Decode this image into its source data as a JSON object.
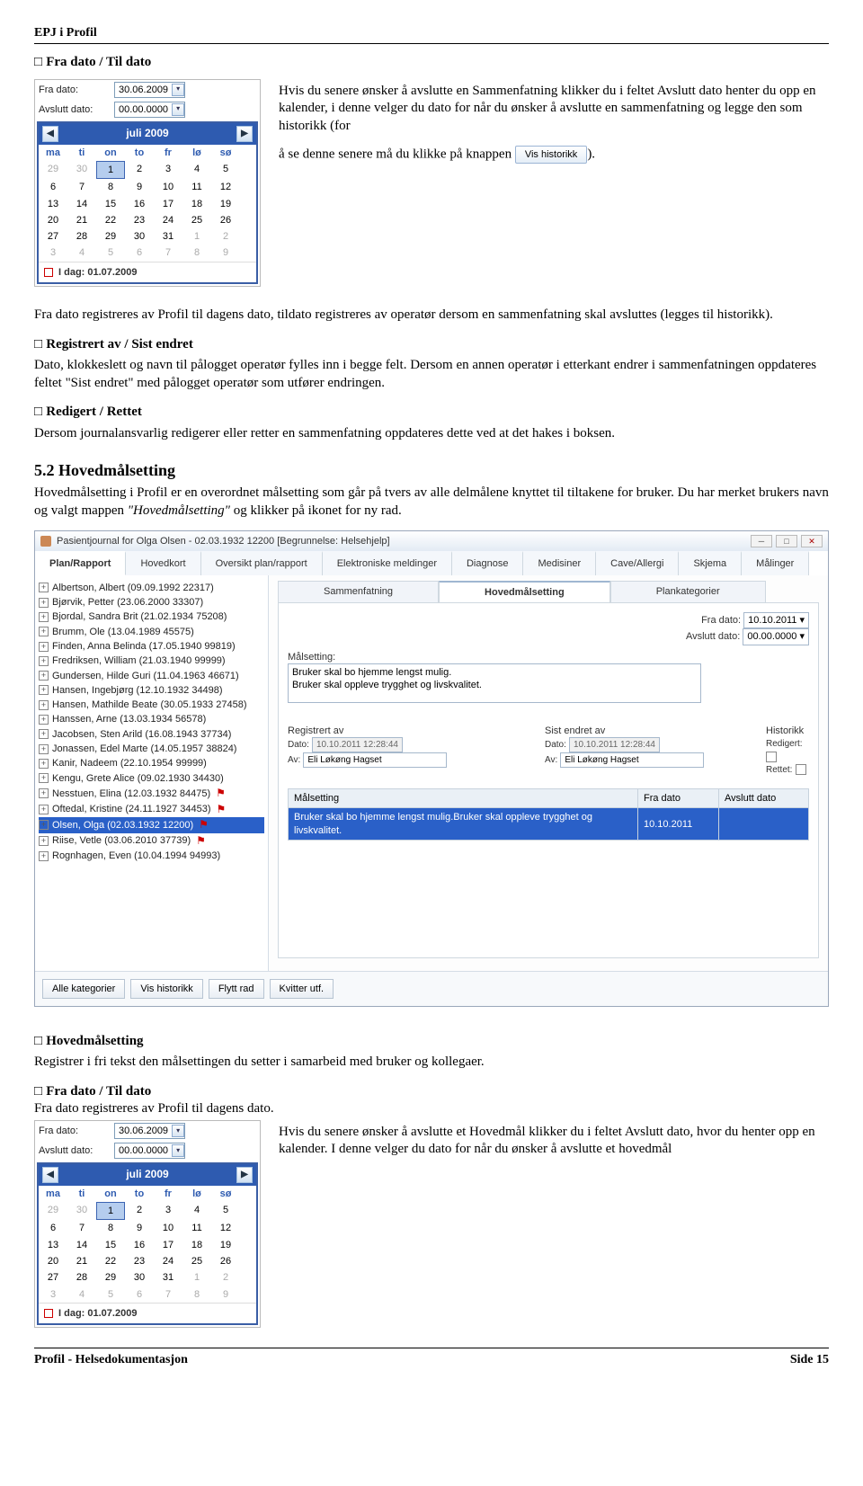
{
  "doc": {
    "header": "EPJ i Profil",
    "s1_title": "Fra dato / Til dato",
    "s1_p1": "Hvis du senere ønsker å avslutte en Sammenfatning klikker du i feltet Avslutt dato henter du opp en kalender, i denne velger du dato for når du ønsker å avslutte en sammenfatning og legge den som historikk (for",
    "s1_p2a": "å se denne senere må du klikke på knappen ",
    "s1_p2b": ").",
    "s1_p3": "Fra dato registreres av Profil til dagens dato, tildato registreres av operatør dersom en sammenfatning skal avsluttes (legges til historikk).",
    "s2_title": "Registrert av / Sist endret",
    "s2_p": "Dato, klokkeslett og navn til pålogget operatør fylles inn i begge felt. Dersom en annen operatør i etterkant endrer i sammenfatningen oppdateres feltet \"Sist endret\" med pålogget operatør som utfører endringen.",
    "s3_title": "Redigert / Rettet",
    "s3_p": "Dersom journalansvarlig redigerer eller retter en sammenfatning oppdateres dette ved at det hakes i boksen.",
    "h52": "5.2 Hovedmålsetting",
    "h52_p": "Hovedmålsetting i Profil er en overordnet målsetting som går på tvers av alle delmålene knyttet til tiltakene for bruker.  Du har merket brukers navn og valgt mappen \"Hovedmålsetting\" og klikker på ikonet for ny rad.",
    "s4_title": "Hovedmålsetting",
    "s4_p": "Registrer i fri tekst den målsettingen du setter i samarbeid med bruker og kollegaer.",
    "s5_title": "Fra dato / Til dato",
    "s5_line": "Fra dato registreres av Profil til dagens dato.",
    "s5_p": "Hvis du senere ønsker å avslutte et Hovedmål klikker du i feltet Avslutt dato, hvor du henter opp en kalender. I denne velger du dato for når du ønsker å avslutte et hovedmål",
    "footer_left": "Profil - Helsedokumentasjon",
    "footer_right": "Side 15"
  },
  "vis_btn": "Vis historikk",
  "dp": {
    "fra_lbl": "Fra dato:",
    "avs_lbl": "Avslutt dato:",
    "fra_val": "30.06.2009",
    "avs_val": "00.00.0000",
    "month": "juli 2009",
    "days": [
      "ma",
      "ti",
      "on",
      "to",
      "fr",
      "lø",
      "sø"
    ],
    "cells": [
      {
        "t": "29",
        "g": 1
      },
      {
        "t": "30",
        "g": 1
      },
      {
        "t": "1",
        "s": 1
      },
      {
        "t": "2"
      },
      {
        "t": "3"
      },
      {
        "t": "4"
      },
      {
        "t": "5"
      },
      {
        "t": "6"
      },
      {
        "t": "7"
      },
      {
        "t": "8"
      },
      {
        "t": "9"
      },
      {
        "t": "10"
      },
      {
        "t": "11"
      },
      {
        "t": "12"
      },
      {
        "t": "13"
      },
      {
        "t": "14"
      },
      {
        "t": "15"
      },
      {
        "t": "16"
      },
      {
        "t": "17"
      },
      {
        "t": "18"
      },
      {
        "t": "19"
      },
      {
        "t": "20"
      },
      {
        "t": "21"
      },
      {
        "t": "22"
      },
      {
        "t": "23"
      },
      {
        "t": "24"
      },
      {
        "t": "25"
      },
      {
        "t": "26"
      },
      {
        "t": "27"
      },
      {
        "t": "28"
      },
      {
        "t": "29"
      },
      {
        "t": "30"
      },
      {
        "t": "31"
      },
      {
        "t": "1",
        "g": 1
      },
      {
        "t": "2",
        "g": 1
      },
      {
        "t": "3",
        "g": 1
      },
      {
        "t": "4",
        "g": 1
      },
      {
        "t": "5",
        "g": 1
      },
      {
        "t": "6",
        "g": 1
      },
      {
        "t": "7",
        "g": 1
      },
      {
        "t": "8",
        "g": 1
      },
      {
        "t": "9",
        "g": 1
      }
    ],
    "today": "I dag: 01.07.2009"
  },
  "app": {
    "title": "Pasientjournal for Olga Olsen - 02.03.1932 12200  [Begrunnelse: Helsehjelp]",
    "tabs": [
      "Plan/Rapport",
      "Hovedkort",
      "Oversikt plan/rapport",
      "Elektroniske meldinger",
      "Diagnose",
      "Medisiner",
      "Cave/Allergi",
      "Skjema",
      "Målinger"
    ],
    "subtabs": [
      "Sammenfatning",
      "Hovedmålsetting",
      "Plankategorier"
    ],
    "sidebar": [
      {
        "t": "Albertson, Albert (09.09.1992 22317)"
      },
      {
        "t": "Bjørvik, Petter (23.06.2000 33307)"
      },
      {
        "t": "Bjordal, Sandra Brit (21.02.1934 75208)"
      },
      {
        "t": "Brumm, Ole (13.04.1989 45575)"
      },
      {
        "t": "Finden, Anna Belinda (17.05.1940 99819)"
      },
      {
        "t": "Fredriksen, William (21.03.1940 99999)"
      },
      {
        "t": "Gundersen, Hilde Guri (11.04.1963 46671)"
      },
      {
        "t": "Hansen, Ingebjørg (12.10.1932 34498)"
      },
      {
        "t": "Hansen, Mathilde Beate (30.05.1933 27458)"
      },
      {
        "t": "Hanssen, Arne (13.03.1934 56578)"
      },
      {
        "t": "Jacobsen, Sten Arild (16.08.1943 37734)"
      },
      {
        "t": "Jonassen, Edel Marte (14.05.1957 38824)"
      },
      {
        "t": "Kanir, Nadeem (22.10.1954 99999)"
      },
      {
        "t": "Kengu, Grete Alice (09.02.1930 34430)"
      },
      {
        "t": "Nesstuen, Elina (12.03.1932 84475)",
        "f": 1
      },
      {
        "t": "Oftedal, Kristine (24.11.1927 34453)",
        "f": 1
      },
      {
        "t": "Olsen, Olga (02.03.1932 12200)",
        "sel": 1,
        "f": 1
      },
      {
        "t": "Riise, Vetle (03.06.2010 37739)",
        "f": 1
      },
      {
        "t": "Rognhagen, Even (10.04.1994 94993)"
      }
    ],
    "fra_lbl": "Fra dato:",
    "fra_val": "10.10.2011",
    "avs_lbl": "Avslutt dato:",
    "avs_val": "00.00.0000",
    "mal_lbl": "Målsetting:",
    "mal_val": "Bruker skal bo hjemme lengst mulig.\nBruker skal oppleve trygghet og livskvalitet.",
    "reg_lbl": "Registrert av",
    "sist_lbl": "Sist endret av",
    "hist_lbl": "Historikk",
    "dato_lbl": "Dato:",
    "dato_val": "10.10.2011  12:28:44",
    "av_lbl": "Av:",
    "av_val": "Eli Løkøng Hagset",
    "red_lbl": "Redigert:",
    "ret_lbl": "Rettet:",
    "grid_h1": "Målsetting",
    "grid_h2": "Fra dato",
    "grid_h3": "Avslutt dato",
    "grid_row": "Bruker skal bo hjemme lengst mulig.Bruker skal oppleve trygghet og livskvalitet.",
    "grid_date": "10.10.2011",
    "btns": [
      "Alle kategorier",
      "Vis historikk",
      "Flytt rad",
      "Kvitter utf."
    ]
  }
}
